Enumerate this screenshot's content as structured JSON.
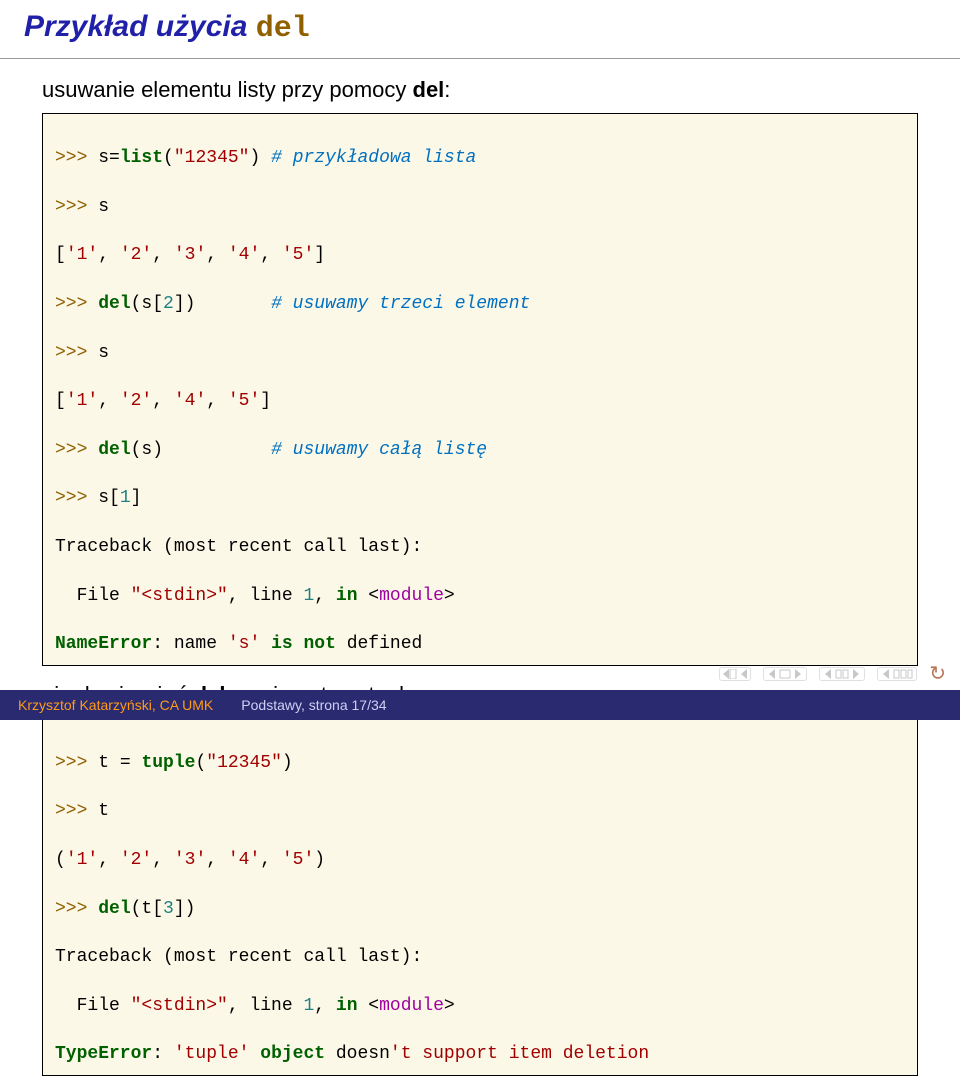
{
  "title": {
    "prefix": "Przykład użycia ",
    "code": "del"
  },
  "lead1": {
    "text_before": "usuwanie elementu listy przy pomocy ",
    "kw": "del",
    "text_after": ":"
  },
  "code1": {
    "l1_prompt": ">>> ",
    "l1_code": "s=",
    "l1_fn": "list",
    "l1_open": "(",
    "l1_str": "\"12345\"",
    "l1_close": ") ",
    "l1_cm": "# przykładowa lista",
    "l2_prompt": ">>> ",
    "l2_code": "s",
    "l3": "[",
    "l3a": "'1'",
    "l3s1": ", ",
    "l3b": "'2'",
    "l3s2": ", ",
    "l3c": "'3'",
    "l3s3": ", ",
    "l3d": "'4'",
    "l3s4": ", ",
    "l3e": "'5'",
    "l3end": "]",
    "l4_prompt": ">>> ",
    "l4_fn": "del",
    "l4_code": "(s[",
    "l4_num": "2",
    "l4_close": "])       ",
    "l4_cm": "# usuwamy trzeci element",
    "l5_prompt": ">>> ",
    "l5_code": "s",
    "l6": "[",
    "l6a": "'1'",
    "l6s1": ", ",
    "l6b": "'2'",
    "l6s2": ", ",
    "l6c": "'4'",
    "l6s3": ", ",
    "l6d": "'5'",
    "l6end": "]",
    "l7_prompt": ">>> ",
    "l7_fn": "del",
    "l7_code": "(s)          ",
    "l7_cm": "# usuwamy całą listę",
    "l8_prompt": ">>> ",
    "l8_code": "s[",
    "l8_num": "1",
    "l8_close": "]",
    "l9": "Traceback (most recent call last):",
    "l10a": "  File ",
    "l10b": "\"<stdin>\"",
    "l10c": ", line ",
    "l10d": "1",
    "l10e": ", ",
    "l10f": "in",
    "l10g": " <",
    "l10h": "module",
    "l10i": ">",
    "l11a": "NameError",
    "l11b": ": name ",
    "l11c": "'s'",
    "l11d": " ",
    "l11e": "is",
    "l11f": " ",
    "l11g": "not",
    "l11h": " defined"
  },
  "lead2": {
    "text_before": "nie da się użyć ",
    "kw": "del",
    "text_after": " na ciągu typu tuple"
  },
  "code2": {
    "l1_prompt": ">>> ",
    "l1_code": "t = ",
    "l1_fn": "tuple",
    "l1_open": "(",
    "l1_str": "\"12345\"",
    "l1_close": ")",
    "l2_prompt": ">>> ",
    "l2_code": "t",
    "l3": "(",
    "l3a": "'1'",
    "l3s1": ", ",
    "l3b": "'2'",
    "l3s2": ", ",
    "l3c": "'3'",
    "l3s3": ", ",
    "l3d": "'4'",
    "l3s4": ", ",
    "l3e": "'5'",
    "l3end": ")",
    "l4_prompt": ">>> ",
    "l4_fn": "del",
    "l4_code": "(t[",
    "l4_num": "3",
    "l4_close": "])",
    "l5": "Traceback (most recent call last):",
    "l6a": "  File ",
    "l6b": "\"<stdin>\"",
    "l6c": ", line ",
    "l6d": "1",
    "l6e": ", ",
    "l6f": "in",
    "l6g": " <",
    "l6h": "module",
    "l6i": ">",
    "l7a": "TypeError",
    "l7b": ": ",
    "l7c": "'tuple'",
    "l7d": " ",
    "l7e": "object",
    "l7f": " doesn",
    "l7g": "'t support item deletion"
  },
  "footer": {
    "author": "Krzysztof Katarzyński, CA UMK",
    "lecture": "Podstawy, strona 17/34"
  }
}
